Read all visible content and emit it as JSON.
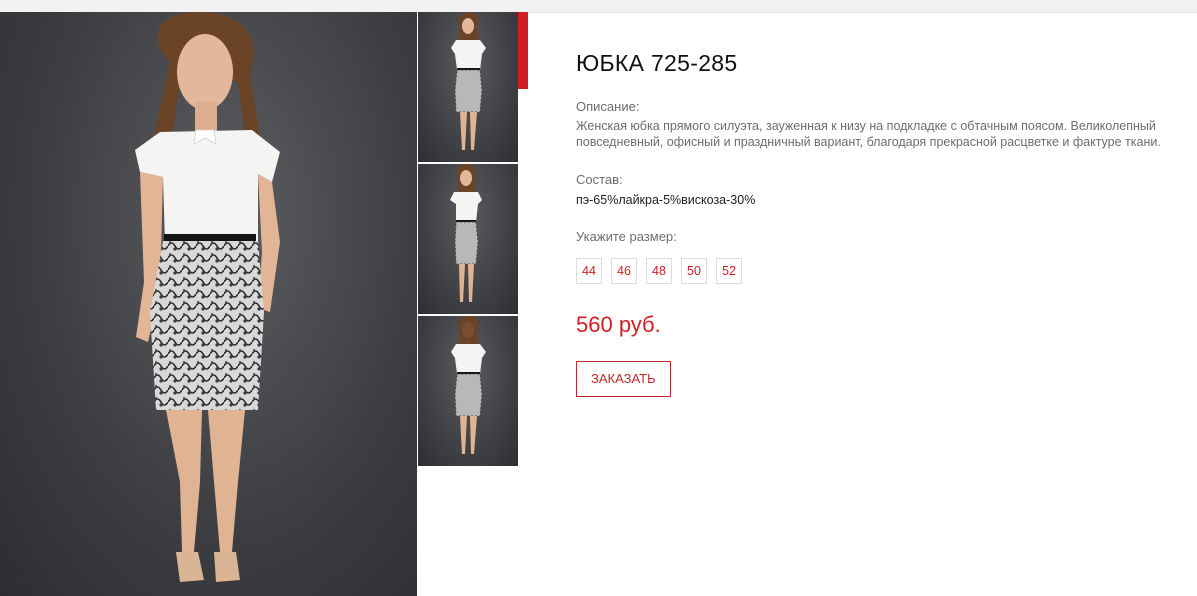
{
  "product": {
    "title": "ЮБКА 725-285",
    "description_label": "Описание:",
    "description": "Женская юбка прямого силуэта, зауженная к низу на подкладке с обтачным поясом. Великолепный повседневный, офисный и праздничный вариант, благодаря прекрасной расцветке и фактуре ткани.",
    "composition_label": "Состав:",
    "composition": "пэ-65%лайкра-5%вискоза-30%",
    "size_label": "Укажите размер:",
    "sizes": [
      "44",
      "46",
      "48",
      "50",
      "52"
    ],
    "price": "560 руб.",
    "order_label": "ЗАКАЗАТЬ"
  },
  "colors": {
    "accent": "#d01f23",
    "photo_background": "#3c3d41"
  }
}
